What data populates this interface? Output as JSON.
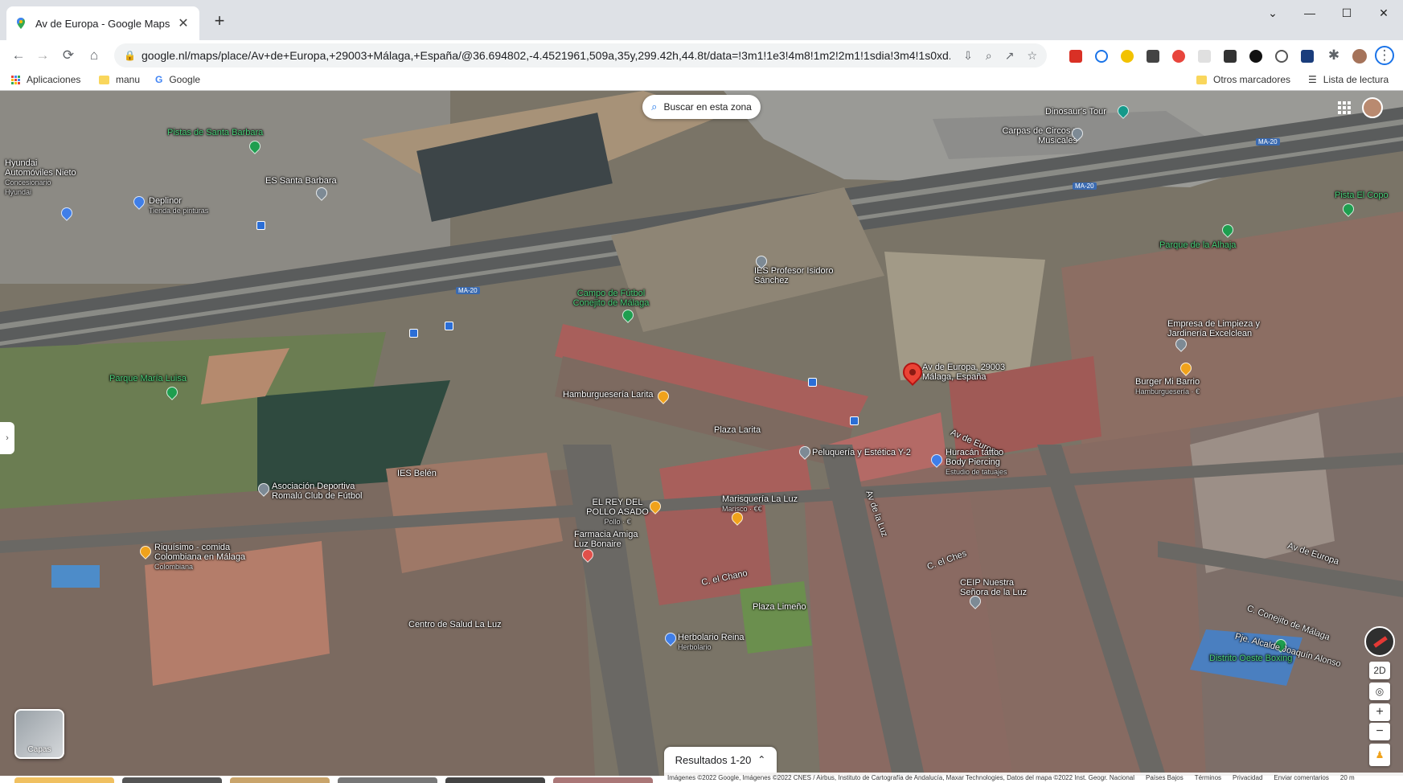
{
  "browser": {
    "tab_title": "Av de Europa - Google Maps",
    "url": "google.nl/maps/place/Av+de+Europa,+29003+Málaga,+España/@36.694802,-4.4521961,509a,35y,299.42h,44.8t/data=!3m1!1e3!4m8!1m2!2m1!1sdia!3m4!1s0xd...",
    "bookmarks": [
      "Aplicaciones",
      "manu",
      "Google"
    ],
    "other_bookmarks": "Otros marcadores",
    "reading_list": "Lista de lectura"
  },
  "map": {
    "search_area_label": "Buscar en esta zona",
    "layers_label": "Capas",
    "results_label": "Resultados 1-20",
    "view_2d_label": "2D",
    "zoom_in": "+",
    "zoom_out": "−",
    "places": [
      {
        "name": "Pistas de Santa Barbara",
        "kind": "green"
      },
      {
        "name": "Hyundai Automóviles Nieto",
        "sub": "Concesionario Hyundai",
        "kind": "white"
      },
      {
        "name": "ES Santa Barbara",
        "kind": "white"
      },
      {
        "name": "Deplinor",
        "sub": "Tienda de pinturas",
        "kind": "white"
      },
      {
        "name": "Dinosaur's Tour",
        "kind": "white"
      },
      {
        "name": "Carpas de Circos y Musicales",
        "kind": "white"
      },
      {
        "name": "Pista El Copo",
        "kind": "green"
      },
      {
        "name": "Parque de la Alhaja",
        "kind": "green"
      },
      {
        "name": "IES Profesor Isidoro Sánchez",
        "kind": "white"
      },
      {
        "name": "Campo de Fútbol Conejito de Málaga",
        "kind": "green"
      },
      {
        "name": "Empresa de Limpieza y Jardinería Excelclean",
        "kind": "white"
      },
      {
        "name": "Parque María Luisa",
        "kind": "green"
      },
      {
        "name": "Av de Europa, 29003 Málaga, España",
        "kind": "white"
      },
      {
        "name": "Burger Mi Barrio",
        "sub": "Hamburguesería · €",
        "kind": "white"
      },
      {
        "name": "Hamburguesería Larita",
        "kind": "white"
      },
      {
        "name": "Plaza Larita",
        "kind": "white"
      },
      {
        "name": "Peluquería y Estética Y-2",
        "kind": "white"
      },
      {
        "name": "Huracán tattoo Body Piercing",
        "sub": "Estudio de tatuajes",
        "kind": "white"
      },
      {
        "name": "IES Belén",
        "kind": "white"
      },
      {
        "name": "Asociación Deportiva Romalú Club de Fútbol",
        "kind": "white"
      },
      {
        "name": "EL REY DEL POLLO ASADO",
        "sub": "Pollo · €",
        "kind": "white"
      },
      {
        "name": "Marisquería La Luz",
        "sub": "Marisco · €€",
        "kind": "white"
      },
      {
        "name": "Riquísimo - comida Colombiana en Málaga",
        "sub": "Colombiana",
        "kind": "white"
      },
      {
        "name": "Farmacia Amiga Luz Bonaire",
        "kind": "white"
      },
      {
        "name": "Plaza Limeño",
        "kind": "white"
      },
      {
        "name": "CEIP Nuestra Señora de la Luz",
        "kind": "white"
      },
      {
        "name": "Centro de Salud La Luz",
        "kind": "white"
      },
      {
        "name": "Herbolario Reina",
        "sub": "Herbolario",
        "kind": "white"
      },
      {
        "name": "Distrito Oeste Boxing",
        "kind": "green"
      },
      {
        "name": "Pje. Alcalde Joaquín Alonso",
        "kind": "white"
      }
    ],
    "streets": [
      "MA-20",
      "MA-20",
      "MA-20",
      "Av de Europa",
      "Av de Europa",
      "C. el Ches",
      "C. el Chano",
      "Av de la Luz",
      "C. Conejito de Málaga"
    ],
    "attribution": [
      "Imágenes ©2022 Google, Imágenes ©2022 CNES / Airbus, Instituto de Cartografía de Andalucía, Maxar Technologies, Datos del mapa ©2022 Inst. Geogr. Nacional",
      "Países Bajos",
      "Términos",
      "Privacidad",
      "Enviar comentarios",
      "20 m"
    ]
  }
}
